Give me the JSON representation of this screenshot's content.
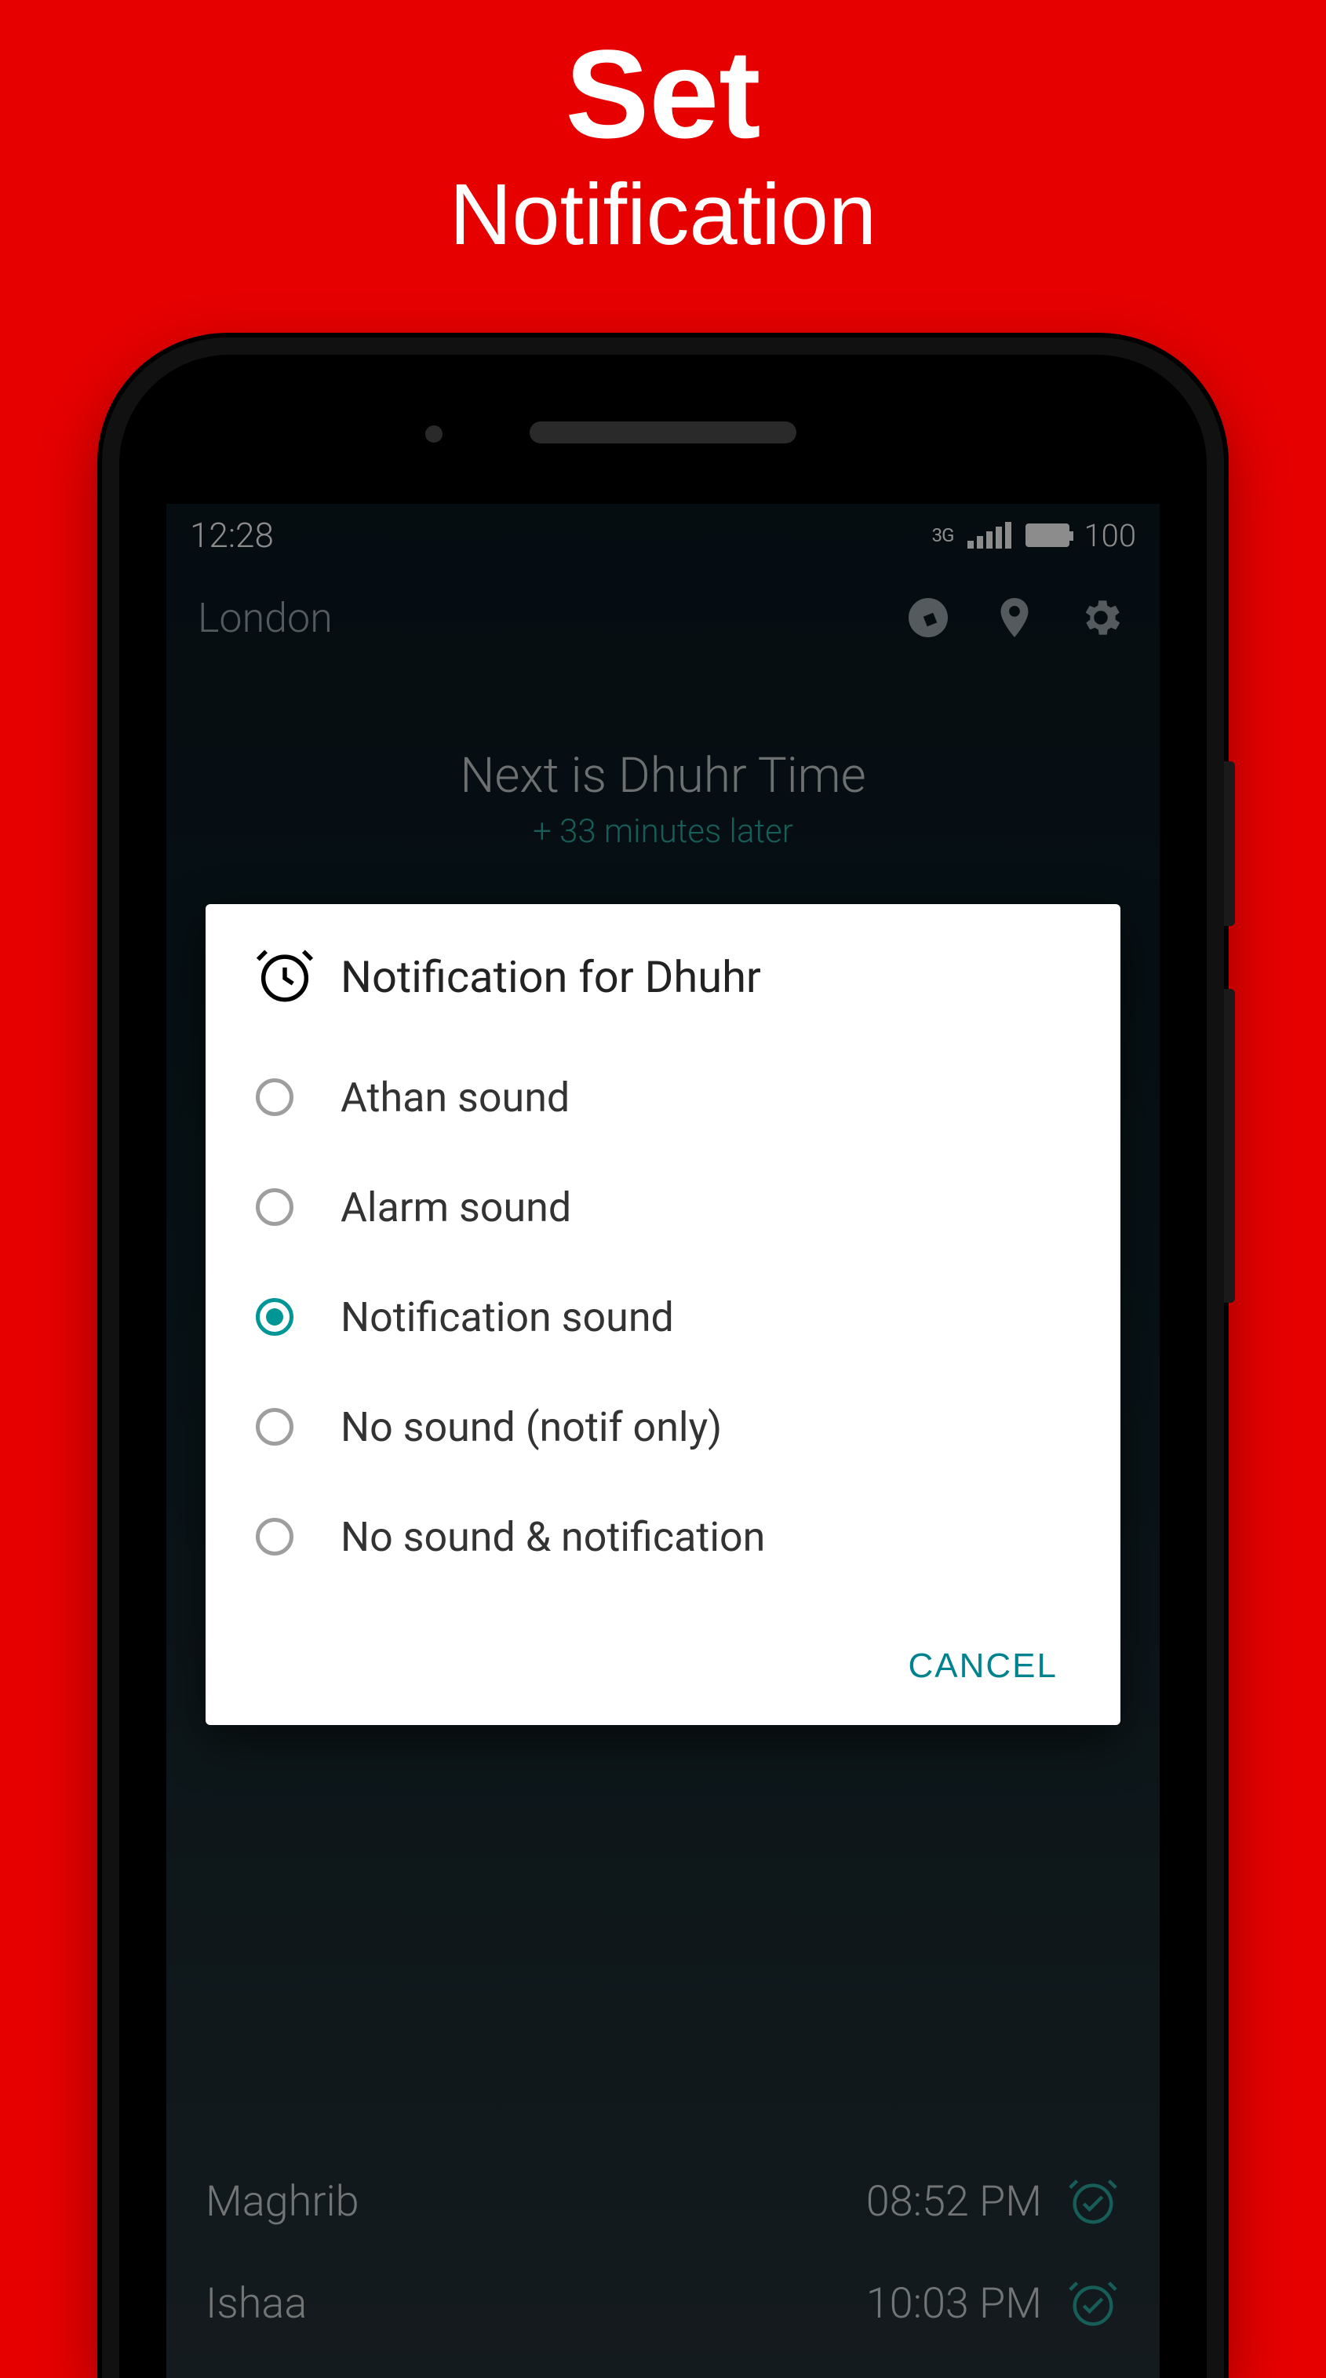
{
  "promo": {
    "line1": "Set",
    "line2": "Notification"
  },
  "status": {
    "time": "12:28",
    "network": "3G",
    "battery_pct": "100"
  },
  "header": {
    "location": "London"
  },
  "next": {
    "title": "Next is Dhuhr Time",
    "sub": "+ 33 minutes later"
  },
  "prayers": [
    {
      "name": "Maghrib",
      "time": "08:52 PM"
    },
    {
      "name": "Ishaa",
      "time": "10:03 PM"
    }
  ],
  "dialog": {
    "title": "Notification for Dhuhr",
    "options": [
      {
        "label": "Athan sound",
        "selected": false
      },
      {
        "label": "Alarm sound",
        "selected": false
      },
      {
        "label": "Notification sound",
        "selected": true
      },
      {
        "label": "No sound (notif only)",
        "selected": false
      },
      {
        "label": "No sound & notification",
        "selected": false
      }
    ],
    "cancel": "CANCEL"
  },
  "colors": {
    "accent": "#009696",
    "bg": "#e60000"
  }
}
